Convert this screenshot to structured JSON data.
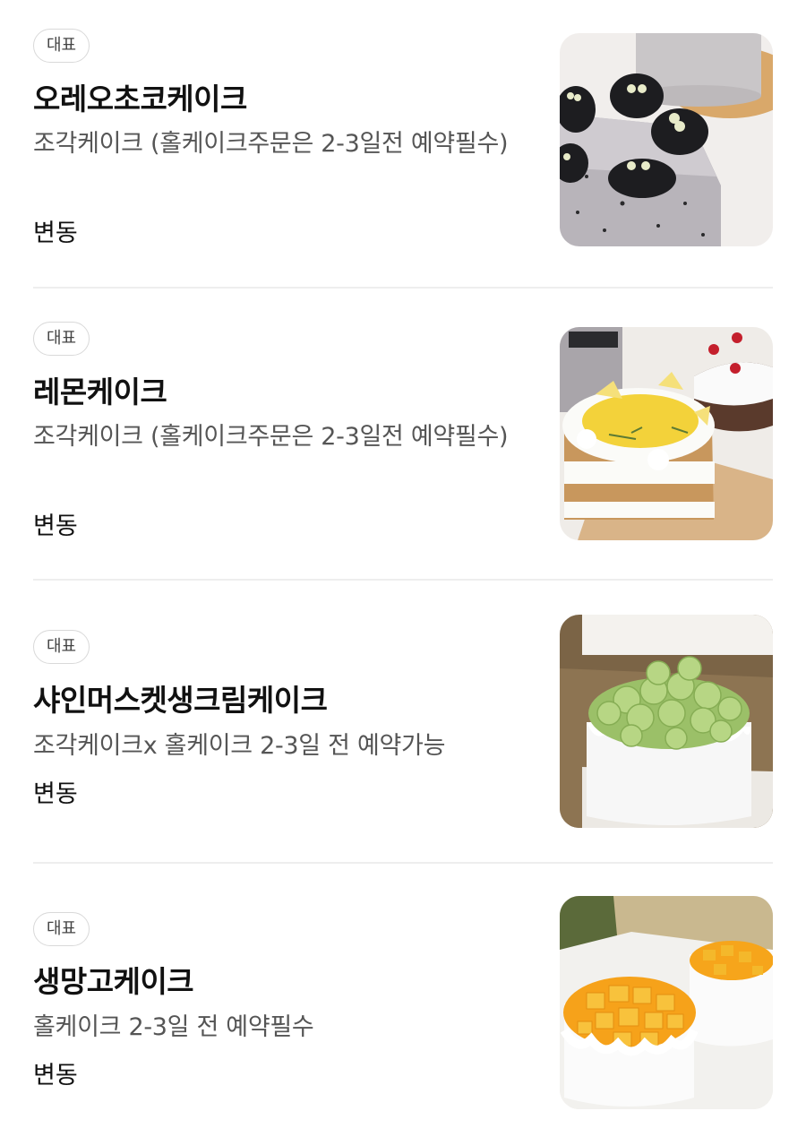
{
  "menu": {
    "items": [
      {
        "badge": "대표",
        "name": "오레오초코케이크",
        "description": "조각케이크 (홀케이크주문은 2-3일전 예약필수)",
        "price": "변동",
        "image_icon": "oreo-cake-photo"
      },
      {
        "badge": "대표",
        "name": "레몬케이크",
        "description": "조각케이크 (홀케이크주문은 2-3일전 예약필수)",
        "price": "변동",
        "image_icon": "lemon-cake-photo"
      },
      {
        "badge": "대표",
        "name": "샤인머스켓생크림케이크",
        "description": "조각케이크x 홀케이크 2-3일 전 예약가능",
        "price": "변동",
        "image_icon": "shine-muscat-cake-photo"
      },
      {
        "badge": "대표",
        "name": "생망고케이크",
        "description": "홀케이크 2-3일 전 예약필수",
        "price": "변동",
        "image_icon": "mango-cake-photo"
      }
    ]
  },
  "colors": {
    "badge_border": "#d9d9d9",
    "title": "#111111",
    "description": "#555555",
    "divider": "#eeeeee"
  }
}
